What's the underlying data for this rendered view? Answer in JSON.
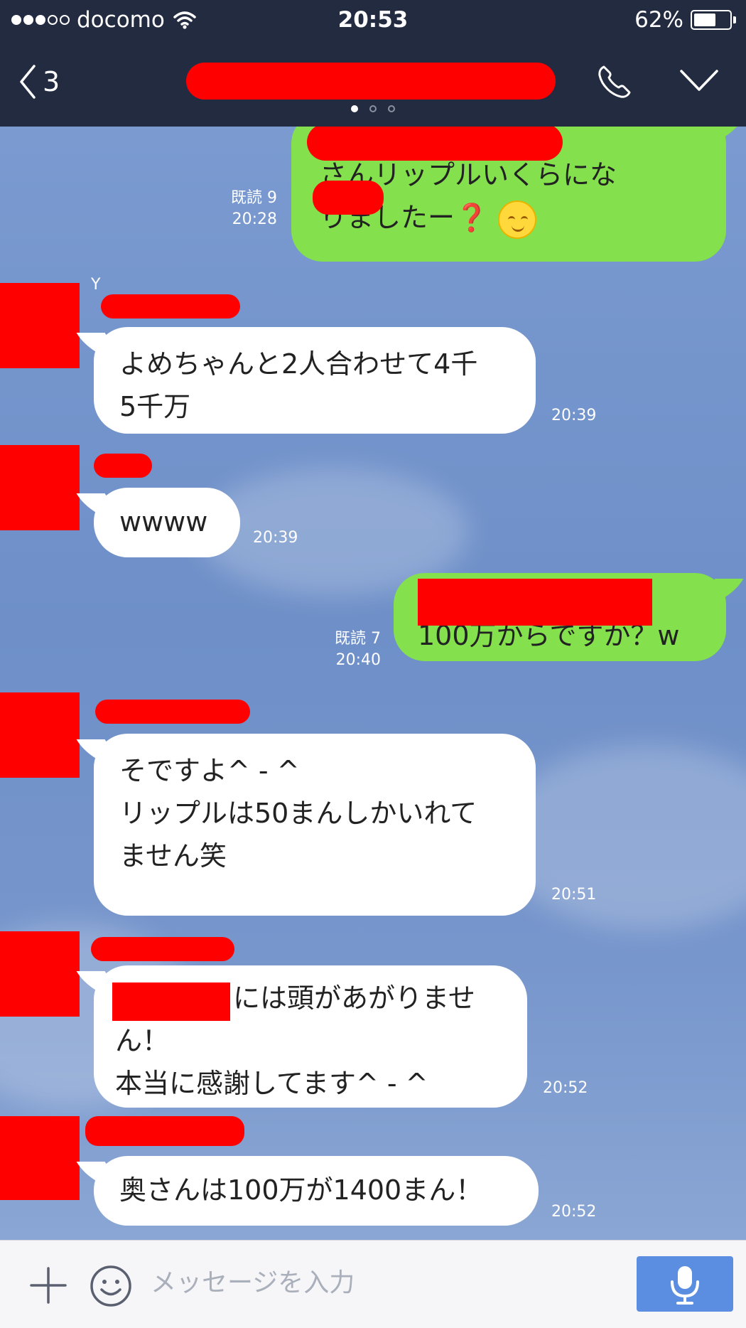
{
  "status_bar": {
    "carrier": "docomo",
    "time": "20:53",
    "battery_percent": "62%",
    "battery_level": 0.62,
    "signal_bars": 3
  },
  "header": {
    "back_count": "3",
    "page_indicator_count": 3,
    "page_indicator_active": 0
  },
  "messages": [
    {
      "side": "out",
      "text": "さんリップルいくらにな\nりましたー",
      "read": "既読 9",
      "time": "20:28"
    },
    {
      "side": "in",
      "text": "よめちゃんと2人合わせて4千\n5千万",
      "time": "20:39"
    },
    {
      "side": "in",
      "text": "wwww",
      "time": "20:39"
    },
    {
      "side": "out",
      "text": "100万からですか？w",
      "read": "既読 7",
      "time": "20:40"
    },
    {
      "side": "in",
      "text": "そですよ^ - ^\nリップルは50まんしかいれて\nません笑",
      "time": "20:51"
    },
    {
      "side": "in",
      "text": "には頭があがりませ\nん！\n本当に感謝してます^ - ^",
      "time": "20:52"
    },
    {
      "side": "in",
      "text": "奥さんは100万が1400まん！",
      "time": "20:52"
    }
  ],
  "message_extras": {
    "question_mark": "❓",
    "sender_initial": "Y"
  },
  "input": {
    "placeholder": "メッセージを入力"
  },
  "colors": {
    "header_bg": "#232b41",
    "outgoing_bubble": "#84e04c",
    "incoming_bubble": "#ffffff",
    "mic_button": "#5b8de0",
    "redaction": "#ff0000"
  },
  "icons": [
    "back-chevron-icon",
    "phone-icon",
    "chevron-down-icon",
    "plus-icon",
    "emoji-icon",
    "microphone-icon",
    "wifi-icon",
    "battery-icon"
  ]
}
